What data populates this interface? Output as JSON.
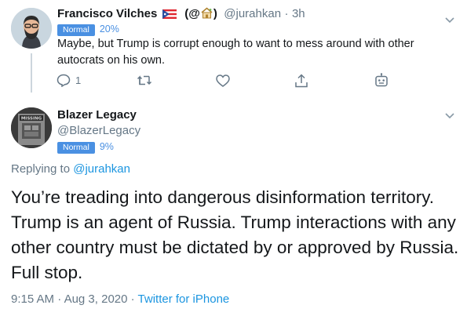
{
  "reply_tweet": {
    "display_name": "Francisco Vilches",
    "paren_open": "(@",
    "paren_close": ")",
    "handle": "@jurahkan",
    "separator": "·",
    "time": "3h",
    "badge": "Normal",
    "badge_pct": "20%",
    "text": "Maybe, but Trump is corrupt enough to want to mess around with other autocrats on his own.",
    "reply_count": "1",
    "icons": [
      "reply-icon",
      "retweet-icon",
      "like-icon",
      "share-icon",
      "bot-icon"
    ]
  },
  "main_tweet": {
    "display_name": "Blazer Legacy",
    "handle": "@BlazerLegacy",
    "badge": "Normal",
    "badge_pct": "9%",
    "avatar_text": "MISSING",
    "replying_prefix": "Replying to",
    "replying_handle": "@jurahkan",
    "text_lines": [
      "You’re treading into dangerous disinformation territory.",
      "Trump is an agent of Russia. Trump interactions with any",
      "other country must be dictated by or approved by Russia.",
      "Full stop."
    ],
    "time": "9:15 AM",
    "date": "Aug 3, 2020",
    "source": "Twitter for iPhone",
    "separator": "·"
  },
  "colors": {
    "badge_blue": "#4a90e2",
    "link_blue": "#1b95e0",
    "muted": "#657786",
    "thread_line": "#ccd6dd"
  }
}
